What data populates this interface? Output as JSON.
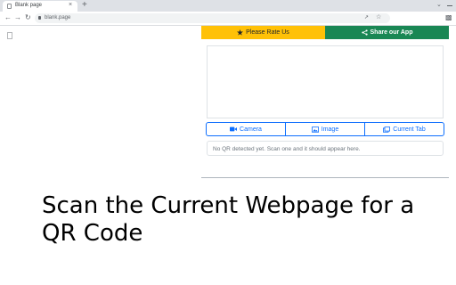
{
  "browser": {
    "tab_title": "Blank page",
    "tab_close": "×",
    "new_tab": "+",
    "url": "blank.page",
    "icons": [
      "page-icon",
      "close-icon",
      "plus-icon",
      "chevron-down-icon",
      "minimize-icon",
      "back-arrow-icon",
      "forward-arrow-icon",
      "reload-icon",
      "lock-icon",
      "share-icon",
      "star-icon",
      "extensions-icon"
    ]
  },
  "popup": {
    "rate_label": "Please Rate Us",
    "share_label": "Share our App",
    "modes": [
      {
        "label": "Camera",
        "icon": "video-camera-icon"
      },
      {
        "label": "Image",
        "icon": "image-icon"
      },
      {
        "label": "Current Tab",
        "icon": "tab-icon"
      }
    ],
    "result_text": "No QR detected yet. Scan one and it should appear here.",
    "colors": {
      "rate": "#ffc107",
      "share": "#198754",
      "primary": "#0d6efd"
    }
  },
  "headline": "Scan the Current Webpage for a QR Code"
}
